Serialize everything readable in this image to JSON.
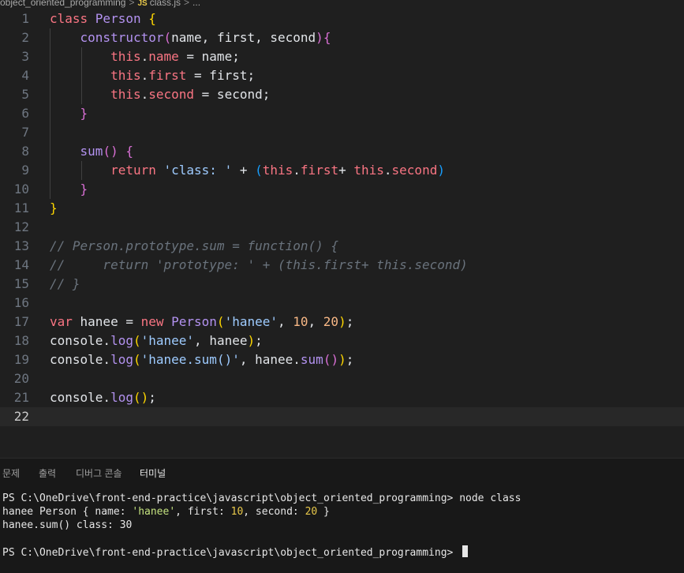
{
  "breadcrumb": {
    "folder": "object_oriented_programming",
    "file_icon": "JS",
    "file": "class.js",
    "more": "..."
  },
  "editor": {
    "lines": [
      {
        "n": "1",
        "tokens": [
          [
            "kw",
            "class "
          ],
          [
            "cls",
            "Person "
          ],
          [
            "br1",
            "{"
          ]
        ]
      },
      {
        "n": "2",
        "tokens": [
          [
            "plain",
            "    "
          ],
          [
            "fn",
            "constructor"
          ],
          [
            "br2",
            "("
          ],
          [
            "plain",
            "name, first, second"
          ],
          [
            "br2",
            ")"
          ],
          [
            "br2",
            "{"
          ]
        ]
      },
      {
        "n": "3",
        "tokens": [
          [
            "plain",
            "        "
          ],
          [
            "kw",
            "this"
          ],
          [
            "plain",
            "."
          ],
          [
            "prop",
            "name"
          ],
          [
            "plain",
            " = name;"
          ]
        ]
      },
      {
        "n": "4",
        "tokens": [
          [
            "plain",
            "        "
          ],
          [
            "kw",
            "this"
          ],
          [
            "plain",
            "."
          ],
          [
            "prop",
            "first"
          ],
          [
            "plain",
            " = first;"
          ]
        ]
      },
      {
        "n": "5",
        "tokens": [
          [
            "plain",
            "        "
          ],
          [
            "kw",
            "this"
          ],
          [
            "plain",
            "."
          ],
          [
            "prop",
            "second"
          ],
          [
            "plain",
            " = second;"
          ]
        ]
      },
      {
        "n": "6",
        "tokens": [
          [
            "plain",
            "    "
          ],
          [
            "br2",
            "}"
          ]
        ]
      },
      {
        "n": "7",
        "tokens": []
      },
      {
        "n": "8",
        "tokens": [
          [
            "plain",
            "    "
          ],
          [
            "fn",
            "sum"
          ],
          [
            "br2",
            "()"
          ],
          [
            "plain",
            " "
          ],
          [
            "br2",
            "{"
          ]
        ]
      },
      {
        "n": "9",
        "tokens": [
          [
            "plain",
            "        "
          ],
          [
            "kw",
            "return "
          ],
          [
            "str",
            "'class: '"
          ],
          [
            "plain",
            " + "
          ],
          [
            "br3",
            "("
          ],
          [
            "kw",
            "this"
          ],
          [
            "plain",
            "."
          ],
          [
            "prop",
            "first"
          ],
          [
            "plain",
            "+ "
          ],
          [
            "kw",
            "this"
          ],
          [
            "plain",
            "."
          ],
          [
            "prop",
            "second"
          ],
          [
            "br3",
            ")"
          ]
        ]
      },
      {
        "n": "10",
        "tokens": [
          [
            "plain",
            "    "
          ],
          [
            "br2",
            "}"
          ]
        ]
      },
      {
        "n": "11",
        "tokens": [
          [
            "br1",
            "}"
          ]
        ]
      },
      {
        "n": "12",
        "tokens": []
      },
      {
        "n": "13",
        "tokens": [
          [
            "cmt",
            "// Person.prototype.sum = function() {"
          ]
        ]
      },
      {
        "n": "14",
        "tokens": [
          [
            "cmt",
            "//     return 'prototype: ' + (this.first+ this.second)"
          ]
        ]
      },
      {
        "n": "15",
        "tokens": [
          [
            "cmt",
            "// }"
          ]
        ]
      },
      {
        "n": "16",
        "tokens": []
      },
      {
        "n": "17",
        "tokens": [
          [
            "kw",
            "var "
          ],
          [
            "plain",
            "hanee = "
          ],
          [
            "kw",
            "new "
          ],
          [
            "cls",
            "Person"
          ],
          [
            "br1",
            "("
          ],
          [
            "str",
            "'hanee'"
          ],
          [
            "plain",
            ", "
          ],
          [
            "num",
            "10"
          ],
          [
            "plain",
            ", "
          ],
          [
            "num",
            "20"
          ],
          [
            "br1",
            ")"
          ],
          [
            "plain",
            ";"
          ]
        ]
      },
      {
        "n": "18",
        "tokens": [
          [
            "plain",
            "console."
          ],
          [
            "fn",
            "log"
          ],
          [
            "br1",
            "("
          ],
          [
            "str",
            "'hanee'"
          ],
          [
            "plain",
            ", hanee"
          ],
          [
            "br1",
            ")"
          ],
          [
            "plain",
            ";"
          ]
        ]
      },
      {
        "n": "19",
        "tokens": [
          [
            "plain",
            "console."
          ],
          [
            "fn",
            "log"
          ],
          [
            "br1",
            "("
          ],
          [
            "str",
            "'hanee.sum()'"
          ],
          [
            "plain",
            ", hanee."
          ],
          [
            "fn",
            "sum"
          ],
          [
            "br2",
            "()"
          ],
          [
            "br1",
            ")"
          ],
          [
            "plain",
            ";"
          ]
        ]
      },
      {
        "n": "20",
        "tokens": []
      },
      {
        "n": "21",
        "tokens": [
          [
            "plain",
            "console."
          ],
          [
            "fn",
            "log"
          ],
          [
            "br1",
            "()"
          ],
          [
            "plain",
            ";"
          ]
        ]
      },
      {
        "n": "22",
        "tokens": []
      }
    ],
    "current_line": "22"
  },
  "panel": {
    "tabs": [
      {
        "label": "문제"
      },
      {
        "label": "출력"
      },
      {
        "label": "디버그 콘솔"
      },
      {
        "label": "터미널"
      }
    ],
    "active_tab": "터미널"
  },
  "terminal": {
    "prompt1": "PS C:\\OneDrive\\front-end-practice\\javascript\\object_oriented_programming> ",
    "command": "node class",
    "out1_pre": "hanee Person { name: ",
    "out1_name": "'hanee'",
    "out1_mid": ", first: ",
    "out1_first": "10",
    "out1_mid2": ", second: ",
    "out1_second": "20",
    "out1_post": " }",
    "out2": "hanee.sum() class: 30",
    "prompt2": "PS C:\\OneDrive\\front-end-practice\\javascript\\object_oriented_programming> "
  }
}
